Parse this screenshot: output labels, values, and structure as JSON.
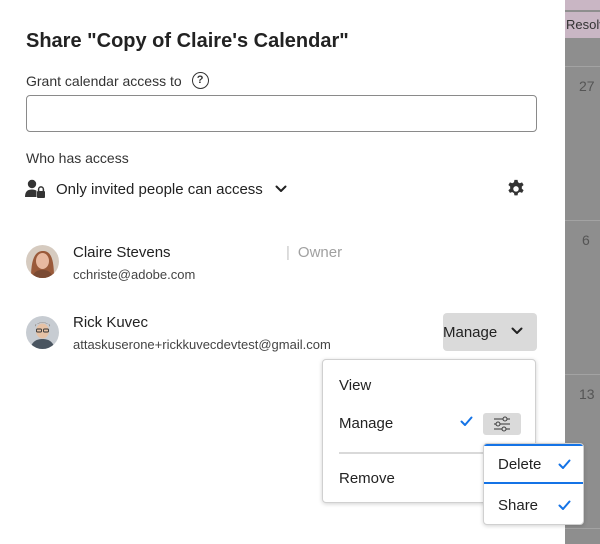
{
  "dialog": {
    "title": "Share \"Copy of Claire's Calendar\"",
    "grant_label": "Grant calendar access to",
    "grant_input_value": "",
    "help_icon_glyph": "?",
    "who_label": "Who has access",
    "access_setting": "Only invited people can access"
  },
  "people": [
    {
      "name": "Claire Stevens",
      "email": "cchriste@adobe.com",
      "role": "Owner"
    },
    {
      "name": "Rick Kuvec",
      "email": "attaskuserone+rickkuvecdevtest@gmail.com",
      "permission": "Manage"
    }
  ],
  "menu": {
    "items": [
      "View",
      "Manage",
      "Remove"
    ],
    "selected": "Manage"
  },
  "submenu": {
    "items": [
      "Delete",
      "Share"
    ]
  },
  "background": {
    "event_text": "Resolv",
    "day_numbers": [
      "27",
      "6",
      "13"
    ]
  },
  "colors": {
    "accent": "#1473e6",
    "button_bg": "#dadada",
    "overlay": "#8e8e8e"
  }
}
